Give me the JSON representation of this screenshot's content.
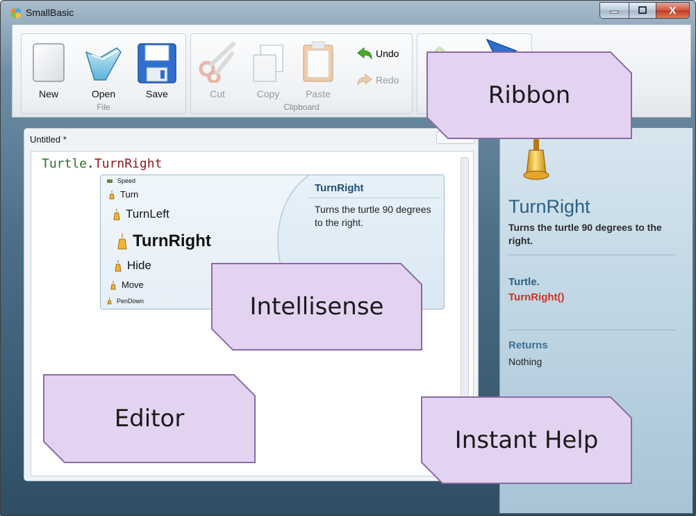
{
  "window": {
    "title": "SmallBasic"
  },
  "controls": {
    "minimize": "—",
    "maximize": "☐",
    "close": "X"
  },
  "ribbon": {
    "file": {
      "label": "File",
      "new": "New",
      "open": "Open",
      "save": "Save"
    },
    "clipboard": {
      "label": "Clipboard",
      "cut": "Cut",
      "copy": "Copy",
      "paste": "Paste",
      "undo": "Undo",
      "redo": "Redo"
    }
  },
  "editor": {
    "tab": "Untitled *",
    "code_object": "Turtle",
    "code_dot": ".",
    "code_operation": "TurnRight"
  },
  "intellisense": {
    "items": [
      "Speed",
      "Turn",
      "TurnLeft",
      "TurnRight",
      "Hide",
      "Move",
      "PenDown"
    ],
    "title": "TurnRight",
    "description": "Turns the turtle 90 degrees to the right."
  },
  "help": {
    "name": "TurnRight",
    "description": "Turns the turtle 90 degrees to the right.",
    "object": "Turtle.",
    "operation": "TurnRight()",
    "returns_heading": "Returns",
    "returns_value": "Nothing"
  },
  "callouts": {
    "ribbon": "Ribbon",
    "intellisense": "Intellisense",
    "editor": "Editor",
    "instant_help": "Instant Help"
  },
  "colors": {
    "callout_fill": "#e3d3f1",
    "callout_stroke": "#8a6aa6",
    "accent_blue": "#2d5f86",
    "operation_red": "#d2301e"
  }
}
